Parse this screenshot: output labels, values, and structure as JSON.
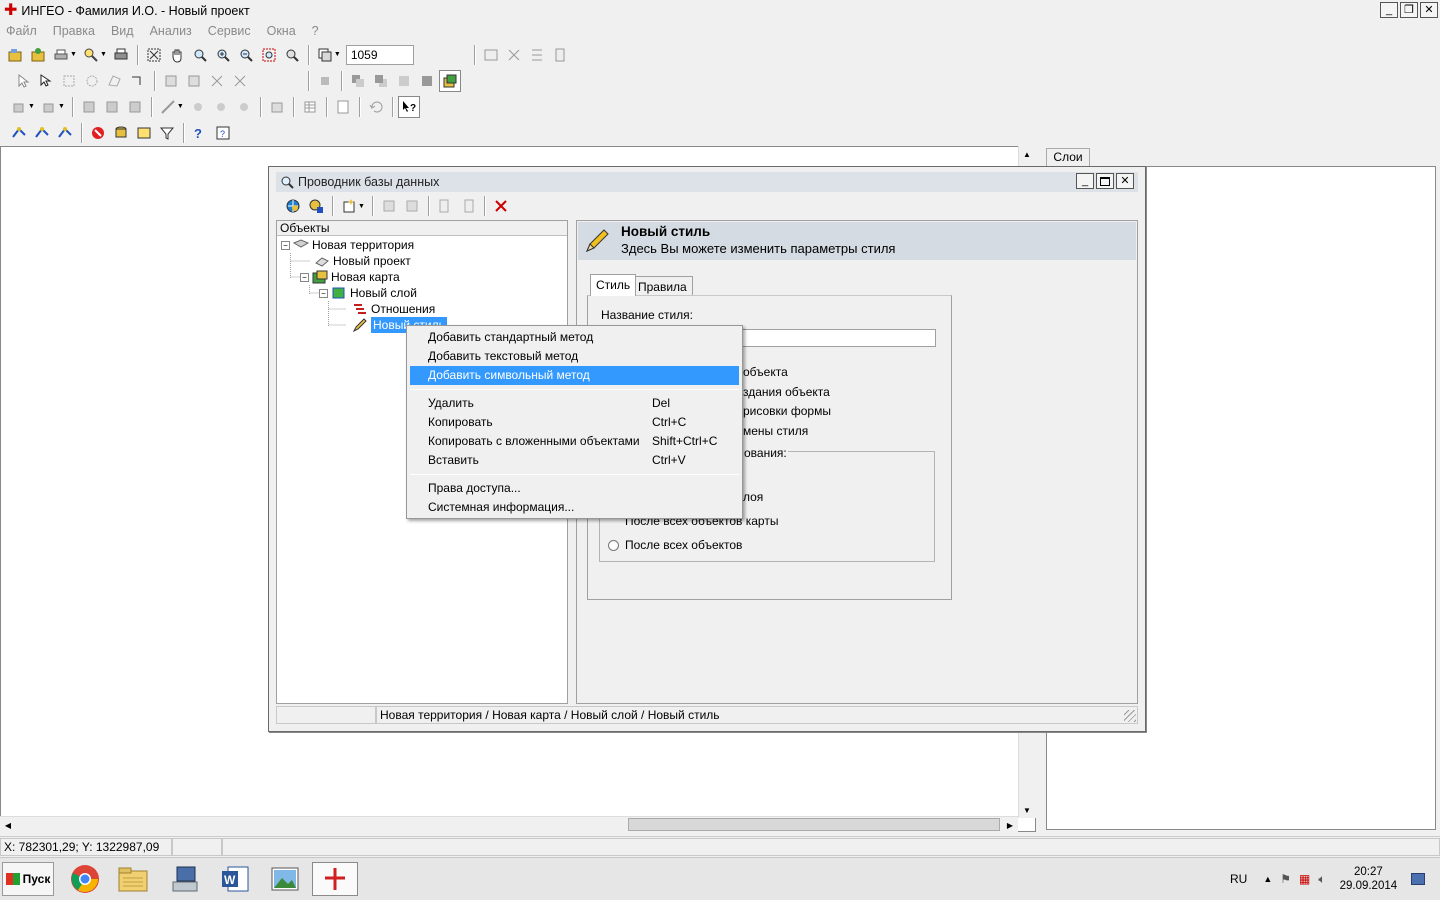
{
  "app": {
    "title": "ИНГЕО - Фамилия И.О. - Новый проект",
    "min": "_",
    "restore": "❐",
    "close": "✕"
  },
  "menu": [
    "Файл",
    "Правка",
    "Вид",
    "Анализ",
    "Сервис",
    "Окна",
    "?"
  ],
  "toolbar": {
    "scale_value": "1059"
  },
  "layers": {
    "tab_label": "Слои"
  },
  "status": {
    "coords": "X: 782301,29; Y: 1322987,09"
  },
  "dialog": {
    "title": "Проводник базы данных",
    "objects_header": "Объекты",
    "tree": [
      {
        "label": "Новая территория"
      },
      {
        "label": "Новый проект"
      },
      {
        "label": "Новая карта"
      },
      {
        "label": "Новый слой"
      },
      {
        "label": "Отношения"
      },
      {
        "label": "Новый стиль"
      }
    ],
    "panel_title": "Новый стиль",
    "panel_subtitle": "Здесь Вы можете изменить параметры стиля",
    "tabs": [
      "Стиль",
      "Правила"
    ],
    "style_name_label": "Название стиля:",
    "partial_texts": [
      "объекта",
      "здания объекта",
      "рисовки формы",
      "мены стиля",
      "ования:",
      "лоя",
      "После всех объектов карты"
    ],
    "radio_last": "После всех объектов",
    "statusbar_path": "Новая территория / Новая карта / Новый слой / Новый стиль"
  },
  "context_menu": {
    "items": [
      {
        "label": "Добавить стандартный метод",
        "shortcut": ""
      },
      {
        "label": "Добавить текстовый метод",
        "shortcut": ""
      },
      {
        "label": "Добавить символьный метод",
        "shortcut": "",
        "highlighted": true
      },
      {
        "label": "Удалить",
        "shortcut": "Del"
      },
      {
        "label": "Копировать",
        "shortcut": "Ctrl+C"
      },
      {
        "label": "Копировать с вложенными объектами",
        "shortcut": "Shift+Ctrl+C"
      },
      {
        "label": "Вставить",
        "shortcut": "Ctrl+V"
      },
      {
        "label": "Права доступа...",
        "shortcut": ""
      },
      {
        "label": "Системная информация...",
        "shortcut": ""
      }
    ]
  },
  "taskbar": {
    "start_label": "Пуск",
    "lang": "RU",
    "time": "20:27",
    "date": "29.09.2014"
  },
  "colors": {
    "highlight": "#3399ff",
    "header_bg": "#d4dbe3",
    "window_bg": "#f0f0f0"
  }
}
